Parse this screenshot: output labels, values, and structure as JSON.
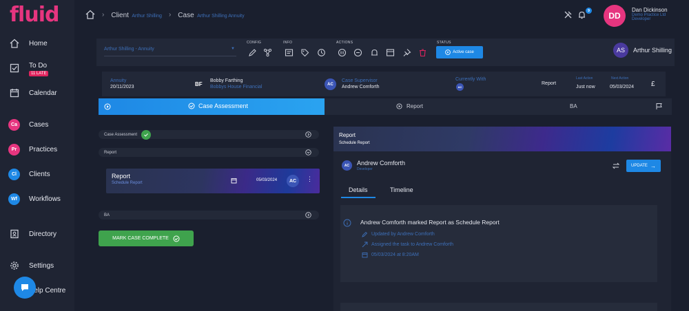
{
  "app": {
    "logo": "fluid"
  },
  "sidebar": {
    "items": [
      {
        "label": "Home"
      },
      {
        "label": "To Do",
        "badge": "11 LATE"
      },
      {
        "label": "Calendar"
      },
      {
        "label": "Cases",
        "abbr": "Ca",
        "color": "#e6357f"
      },
      {
        "label": "Practices",
        "abbr": "Pr",
        "color": "#e6357f"
      },
      {
        "label": "Clients",
        "abbr": "Cl",
        "color": "#1e88e5"
      },
      {
        "label": "Workflows",
        "abbr": "Wf",
        "color": "#1e88e5"
      },
      {
        "label": "Directory"
      },
      {
        "label": "Settings"
      },
      {
        "label": "Help Centre"
      }
    ]
  },
  "breadcrumb": {
    "client_label": "Client",
    "client_value": "Arthur Shilling",
    "case_label": "Case",
    "case_value": "Arthur Shilling Annuity"
  },
  "header": {
    "notification_count": "9",
    "user_initials": "DD",
    "user_name": "Dan Dickinson",
    "user_org": "Demo Practice Ltd",
    "user_role": "Developer",
    "user_avatar_color": "#e6357f"
  },
  "toolbar": {
    "case_select": "Arthur Shilling - Annuity",
    "config_label": "CONFIG",
    "info_label": "INFO",
    "actions_label": "ACTIONS",
    "status_label": "STATUS",
    "status_button": "Active case",
    "client_initials": "AS",
    "client_name": "Arthur Shilling"
  },
  "info_row": {
    "product": "Annuity",
    "date": "20/11/2023",
    "adviser_initials": "BF",
    "adviser_name": "Bobby Farthing",
    "adviser_firm": "Bobbys House Financial",
    "supervisor_initials": "AC",
    "supervisor_label": "Case Supervisor",
    "supervisor_name": "Andrew Comforth",
    "currently_with_label": "Currently With",
    "currently_with_initials": "AC",
    "stage": "Report",
    "last_action_label": "Last Action",
    "last_action_value": "Just now",
    "next_action_label": "Next Action",
    "next_action_value": "05/03/2024",
    "currency_symbol": "£"
  },
  "steps": {
    "active": "Case Assessment",
    "report": "Report",
    "ba": "BA"
  },
  "left_panel": {
    "rows": [
      {
        "label": "Case Assessment"
      },
      {
        "label": "Report"
      },
      {
        "label": "BA"
      }
    ],
    "task_card": {
      "title": "Report",
      "subtitle": "Schedule Report",
      "date": "05/03/2024",
      "assignee_initials": "AC"
    },
    "complete_button": "MARK CASE COMPLETE"
  },
  "right_panel": {
    "header_title": "Report",
    "header_subtitle": "Schedule Report",
    "assignee_initials": "AC",
    "assignee_name": "Andrew Comforth",
    "assignee_role": "Developer",
    "update_button": "UPDATE",
    "tabs": [
      "Details",
      "Timeline"
    ],
    "activity": {
      "title": "Andrew Comforth marked Report as Schedule Report",
      "lines": [
        "Updated by Andrew Comforth",
        "Assigned the task to Andrew Comforth",
        "05/03/2024 at 8:20AM"
      ]
    }
  }
}
